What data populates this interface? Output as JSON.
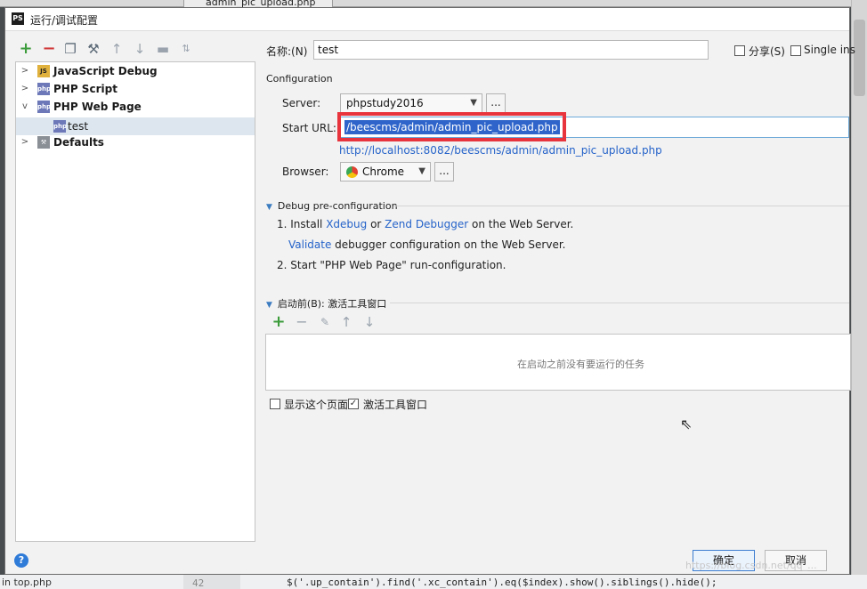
{
  "background": {
    "tab_label": "admin_pic_upload.php",
    "bottom_file": "in top.php",
    "line_number": "42",
    "code_line": "$('.up_contain').find('.xc_contain').eq($index).show().siblings().hide();"
  },
  "dialog": {
    "title": "运行/调试配置",
    "app_icon": "PS"
  },
  "toolbar": {
    "icons": [
      "plus-icon",
      "minus-icon",
      "copy-icon",
      "wrench-icon",
      "arrow-up-icon",
      "arrow-down-icon",
      "folder-icon",
      "sort-icon"
    ]
  },
  "tree": {
    "items": [
      {
        "label": "JavaScript Debug",
        "icon": "javascript-debug-icon"
      },
      {
        "label": "PHP Script",
        "icon": "php-script-icon"
      },
      {
        "label": "PHP Web Page",
        "icon": "php-web-page-icon"
      },
      {
        "label": "test",
        "icon": "php-web-page-icon"
      },
      {
        "label": "Defaults",
        "icon": "wrench-icon"
      }
    ]
  },
  "form": {
    "name_label": "名称:(N)",
    "name_value": "test",
    "share_label": "分享(S)",
    "single_instance_label": "Single ins",
    "configuration_label": "Configuration",
    "server_label": "Server:",
    "server_value": "phpstudy2016",
    "start_url_label": "Start URL:",
    "start_url_value": "/beescms/admin/admin_pic_upload.php",
    "full_url": "http://localhost:8082/beescms/admin/admin_pic_upload.php",
    "browser_label": "Browser:",
    "browser_value": "Chrome",
    "dots": "..."
  },
  "debug": {
    "heading": "Debug pre-configuration",
    "step1_prefix": "1. Install ",
    "xdebug": "Xdebug",
    "or": " or ",
    "zend": "Zend Debugger",
    "step1_suffix": " on the Web Server.",
    "validate": "Validate",
    "validate_suffix": " debugger configuration on the Web Server.",
    "step2": "2. Start \"PHP Web Page\" run-configuration."
  },
  "before_launch": {
    "heading": "启动前(B): 激活工具窗口",
    "empty_text": "在启动之前没有要运行的任务",
    "show_page_label": "显示这个页面",
    "activate_tool_label": "激活工具窗口"
  },
  "buttons": {
    "ok": "确定",
    "cancel": "取消",
    "help": "?"
  },
  "watermark": "https://blog.csdn.net/qq_..."
}
